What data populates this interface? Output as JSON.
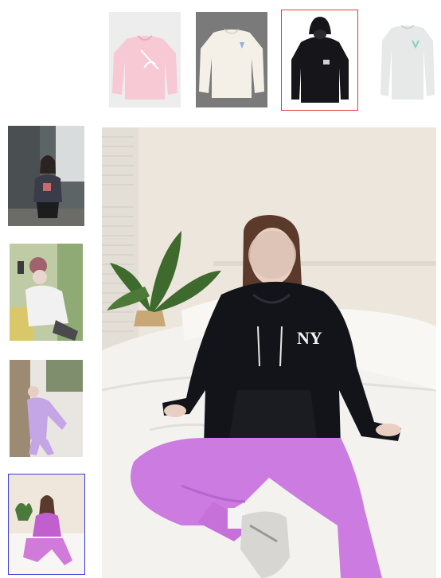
{
  "gallery": {
    "color_swatches": [
      {
        "name": "pink",
        "color": "#f6c9d6"
      },
      {
        "name": "ivory",
        "color": "#f3efe6"
      },
      {
        "name": "black",
        "color": "#141418",
        "selected": true
      },
      {
        "name": "light-gray",
        "color": "#e6e8e8"
      }
    ],
    "thumbnails": [
      {
        "scene": "model-gray-sweatshirt-outdoor"
      },
      {
        "scene": "model-white-hoodie-selfie"
      },
      {
        "scene": "model-lilac-set-street"
      },
      {
        "scene": "model-black-hoodie-bed",
        "selected": true
      }
    ],
    "main_image": {
      "scene": "model-black-hoodie-on-bed",
      "logo_text": "NY"
    },
    "colors": {
      "swatch_selected_border": "#e23a3a",
      "thumb_selected_border": "#3b3bd6"
    }
  }
}
